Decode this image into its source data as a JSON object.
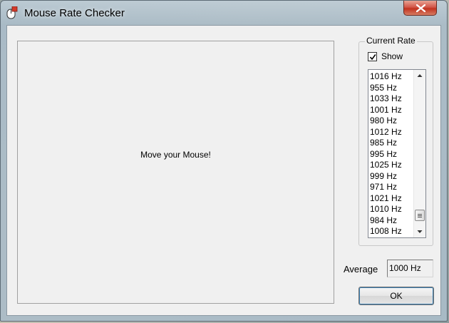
{
  "window": {
    "title": "Mouse Rate Checker",
    "close_label": "X"
  },
  "canvas": {
    "message": "Move your Mouse!"
  },
  "current_rate": {
    "group_label": "Current Rate",
    "show_label": "Show",
    "show_checked": true,
    "rates": [
      "1016 Hz",
      "955 Hz",
      "1033 Hz",
      "1001 Hz",
      "980 Hz",
      "1012 Hz",
      "985 Hz",
      "995 Hz",
      "1025 Hz",
      "999 Hz",
      "971 Hz",
      "1021 Hz",
      "1010 Hz",
      "984 Hz",
      "1008 Hz"
    ]
  },
  "average": {
    "label": "Average",
    "value": "1000 Hz"
  },
  "buttons": {
    "ok_label": "OK"
  }
}
